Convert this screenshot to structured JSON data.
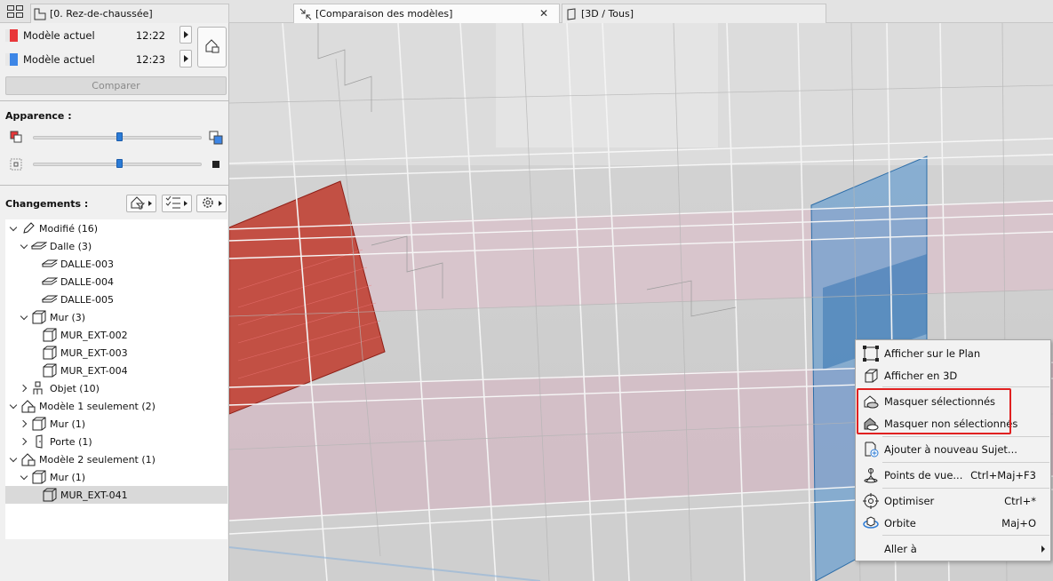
{
  "tabs": {
    "plan": "[0. Rez-de-chaussée]",
    "compare": "[Comparaison des modèles]",
    "compare_close": "✕",
    "view3d": "[3D / Tous]"
  },
  "models": [
    {
      "name": "Modèle actuel",
      "time": "12:22",
      "color": "#e8373a"
    },
    {
      "name": "Modèle actuel",
      "time": "12:23",
      "color": "#3d86e6"
    }
  ],
  "compare_button": "Comparer",
  "appearance_label": "Apparence :",
  "appearance_sliders": [
    {
      "name": "color-intensity",
      "value": 0.51
    },
    {
      "name": "transparency",
      "value": 0.51
    }
  ],
  "changes_label": "Changements :",
  "tree": [
    {
      "label": "Modifié (16)",
      "icon": "pencil-icon",
      "level": 0,
      "state": "open"
    },
    {
      "label": "Dalle (3)",
      "icon": "slab-icon",
      "level": 1,
      "state": "open"
    },
    {
      "label": "DALLE-003",
      "icon": "slab-icon",
      "level": 2,
      "state": "leaf"
    },
    {
      "label": "DALLE-004",
      "icon": "slab-icon",
      "level": 2,
      "state": "leaf"
    },
    {
      "label": "DALLE-005",
      "icon": "slab-icon",
      "level": 2,
      "state": "leaf"
    },
    {
      "label": "Mur (3)",
      "icon": "wall-icon",
      "level": 1,
      "state": "open"
    },
    {
      "label": "MUR_EXT-002",
      "icon": "wall-icon",
      "level": 2,
      "state": "leaf"
    },
    {
      "label": "MUR_EXT-003",
      "icon": "wall-icon",
      "level": 2,
      "state": "leaf"
    },
    {
      "label": "MUR_EXT-004",
      "icon": "wall-icon",
      "level": 2,
      "state": "leaf"
    },
    {
      "label": "Objet (10)",
      "icon": "object-icon",
      "level": 1,
      "state": "closed"
    },
    {
      "label": "Modèle 1 seulement (2)",
      "icon": "model-icon",
      "level": 0,
      "state": "open"
    },
    {
      "label": "Mur (1)",
      "icon": "wall-icon",
      "level": 1,
      "state": "closed"
    },
    {
      "label": "Porte (1)",
      "icon": "door-icon",
      "level": 1,
      "state": "closed"
    },
    {
      "label": "Modèle 2 seulement (1)",
      "icon": "model-icon",
      "level": 0,
      "state": "open"
    },
    {
      "label": "Mur (1)",
      "icon": "wall-icon",
      "level": 1,
      "state": "open"
    },
    {
      "label": "MUR_EXT-041",
      "icon": "wall-icon",
      "level": 2,
      "state": "leaf",
      "selected": true
    }
  ],
  "context_menu": {
    "items": [
      {
        "label": "Afficher sur le Plan",
        "shortcut": "",
        "icon": "show-on-plan-icon"
      },
      {
        "label": "Afficher en 3D",
        "shortcut": "",
        "icon": "show-in-3d-icon"
      },
      {
        "label": "Masquer sélectionnés",
        "shortcut": "",
        "icon": "hide-selected-icon"
      },
      {
        "label": "Masquer non sélectionnés",
        "shortcut": "",
        "icon": "hide-unselected-icon"
      },
      {
        "label": "Ajouter à nouveau Sujet...",
        "shortcut": "",
        "icon": "add-issue-icon"
      },
      {
        "label": "Points de vue...",
        "shortcut": "Ctrl+Maj+F3",
        "icon": "viewpoints-icon"
      },
      {
        "label": "Optimiser",
        "shortcut": "Ctrl+*",
        "icon": "optimize-icon"
      },
      {
        "label": "Orbite",
        "shortcut": "Maj+O",
        "icon": "orbit-icon"
      },
      {
        "label": "Aller à",
        "shortcut": "",
        "icon": "goto-icon"
      }
    ]
  },
  "colors": {
    "model1": "#e8373a",
    "model2": "#3d86e6",
    "highlight": "#e02020",
    "slider": "#2b7bd6"
  }
}
